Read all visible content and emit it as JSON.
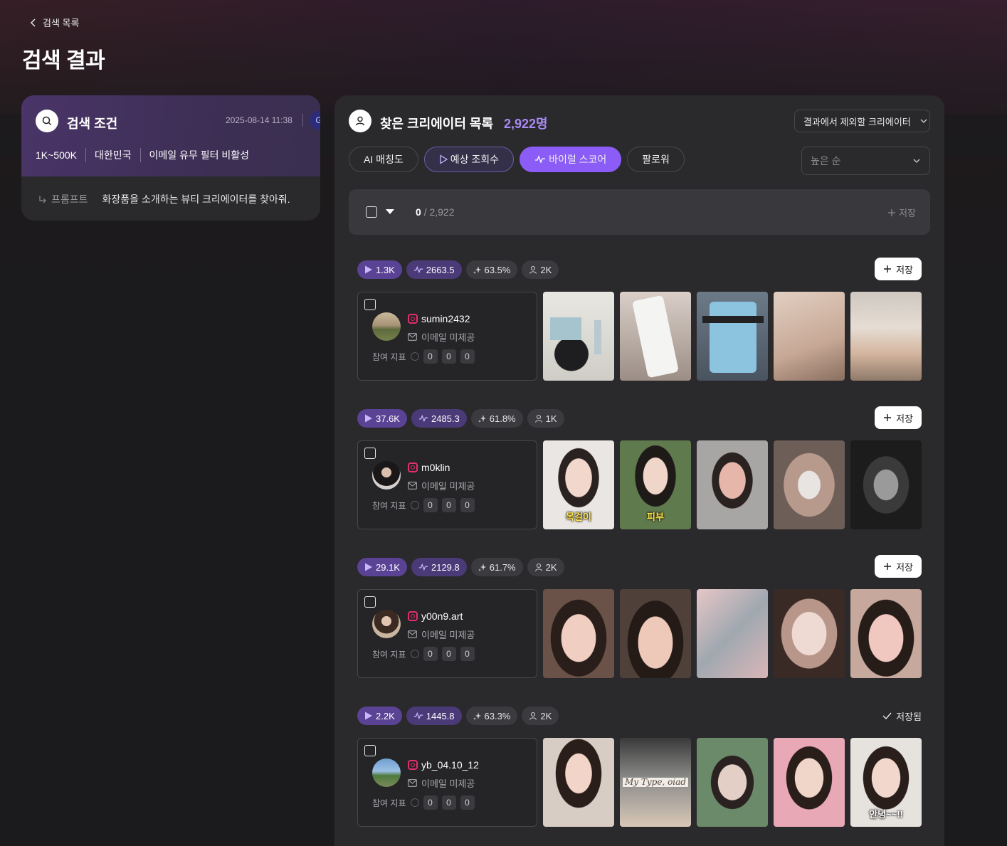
{
  "nav": {
    "back_label": "검색 목록"
  },
  "page": {
    "title": "검색 결과"
  },
  "conditions": {
    "title": "검색 조건",
    "date": "2025-08-14 11:38",
    "user_initial": "G",
    "tags": [
      "1K~500K",
      "대한민국",
      "이메일 유무 필터 비활성"
    ],
    "prompt_label": "프롬프트",
    "prompt_text": "화장품을 소개하는 뷰티 크리에이터를 찾아줘."
  },
  "results": {
    "title": "찾은 크리에이터 목록",
    "count": "2,922명",
    "exclude_label": "결과에서 제외할 크리에이터",
    "tabs": [
      "AI 매칭도",
      "예상 조회수",
      "바이럴 스코어",
      "팔로워"
    ],
    "sort_placeholder": "높은 순",
    "selected": "0",
    "total": "/ 2,922",
    "save_label": "저장"
  },
  "colors": {
    "accent": "#8b5cf6",
    "count": "#a98af6",
    "instagram": "#e1306c"
  },
  "creators": [
    {
      "views": "1.3K",
      "viral": "2663.5",
      "ai": "63.5%",
      "followers": "2K",
      "handle": "sumin2432",
      "email": "이메일 미제공",
      "engagement_label": "참여 지표",
      "eng": [
        "0",
        "0",
        "0"
      ],
      "action": "저장",
      "saved": false,
      "thumb_captions": [
        "",
        "",
        "",
        "",
        ""
      ]
    },
    {
      "views": "37.6K",
      "viral": "2485.3",
      "ai": "61.8%",
      "followers": "1K",
      "handle": "m0klin",
      "email": "이메일 미제공",
      "engagement_label": "참여 지표",
      "eng": [
        "0",
        "0",
        "0"
      ],
      "action": "저장",
      "saved": false,
      "thumb_captions": [
        "목걸이",
        "피부",
        "",
        "",
        ""
      ]
    },
    {
      "views": "29.1K",
      "viral": "2129.8",
      "ai": "61.7%",
      "followers": "2K",
      "handle": "y00n9.art",
      "email": "이메일 미제공",
      "engagement_label": "참여 지표",
      "eng": [
        "0",
        "0",
        "0"
      ],
      "action": "저장",
      "saved": false,
      "thumb_captions": [
        "",
        "",
        "",
        "",
        ""
      ]
    },
    {
      "views": "2.2K",
      "viral": "1445.8",
      "ai": "63.3%",
      "followers": "2K",
      "handle": "yb_04.10_12",
      "email": "이메일 미제공",
      "engagement_label": "참여 지표",
      "eng": [
        "0",
        "0",
        "0"
      ],
      "action": "저장됨",
      "saved": true,
      "thumb_captions": [
        "",
        "My Type, oiad",
        "",
        "",
        "안녕~~!!"
      ]
    }
  ]
}
